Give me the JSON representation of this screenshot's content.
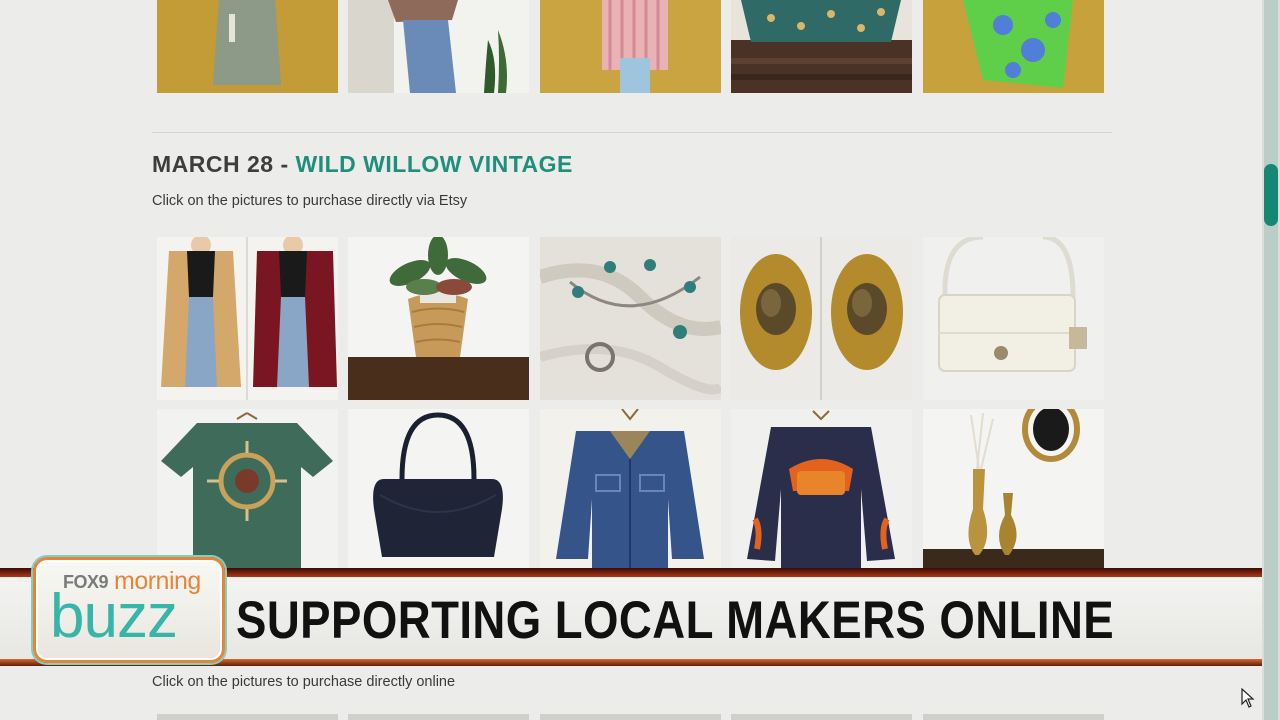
{
  "section": {
    "date": "MARCH 28",
    "separator": " - ",
    "shop_name": "WILD WILLOW VINTAGE",
    "instruction": "Click on the pictures to purchase directly via Etsy"
  },
  "next_section": {
    "instruction": "Click on the pictures to purchase directly online"
  },
  "broadcast": {
    "logo_network": "FOX9",
    "logo_word_1": "morning",
    "logo_word_2": "buzz",
    "headline": "SUPPORTING LOCAL MAKERS ONLINE"
  },
  "colors": {
    "accent": "#1f8f7c",
    "logo_orange": "#e8843a",
    "logo_teal": "#36b5a8"
  },
  "icons": [
    "mouse-cursor-icon"
  ]
}
